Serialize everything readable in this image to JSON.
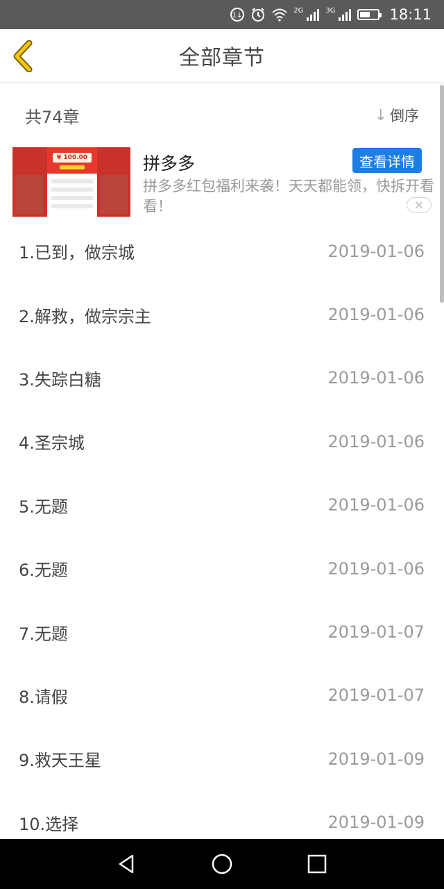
{
  "status_bar": {
    "time": "18:11",
    "network_1": "2G",
    "network_2": "3G",
    "battery_level": 0.6,
    "icons": [
      "data-saver-icon",
      "alarm-icon",
      "wifi-icon",
      "signal-2g-icon",
      "signal-3g-icon",
      "battery-icon"
    ]
  },
  "header": {
    "title": "全部章节",
    "back_icon": "chevron-left-icon"
  },
  "sub_header": {
    "count": "共74章",
    "sort_label": "倒序",
    "sort_icon": "arrow-down-icon"
  },
  "ad": {
    "title": "拼多多",
    "description": "拼多多红包福利来袭！天天都能领，快拆开看看！",
    "detail_button": "查看详情",
    "close_icon": "close-icon",
    "thumb_amount": "¥ 100.00"
  },
  "chapters": [
    {
      "title": "1.已到，做宗城",
      "date": "2019-01-06"
    },
    {
      "title": "2.解救，做宗宗主",
      "date": "2019-01-06"
    },
    {
      "title": "3.失踪白糖",
      "date": "2019-01-06"
    },
    {
      "title": "4.圣宗城",
      "date": "2019-01-06"
    },
    {
      "title": "5.无题",
      "date": "2019-01-06"
    },
    {
      "title": "6.无题",
      "date": "2019-01-06"
    },
    {
      "title": "7.无题",
      "date": "2019-01-07"
    },
    {
      "title": "8.请假",
      "date": "2019-01-07"
    },
    {
      "title": "9.救天王星",
      "date": "2019-01-09"
    },
    {
      "title": "10.选择",
      "date": "2019-01-09"
    }
  ],
  "colors": {
    "accent_back": "#f5c518",
    "ad_button": "#1e7de5",
    "status_bar": "#5a5a5a"
  },
  "nav_bar": {
    "icons": [
      "back-triangle-icon",
      "home-circle-icon",
      "recents-square-icon"
    ]
  }
}
